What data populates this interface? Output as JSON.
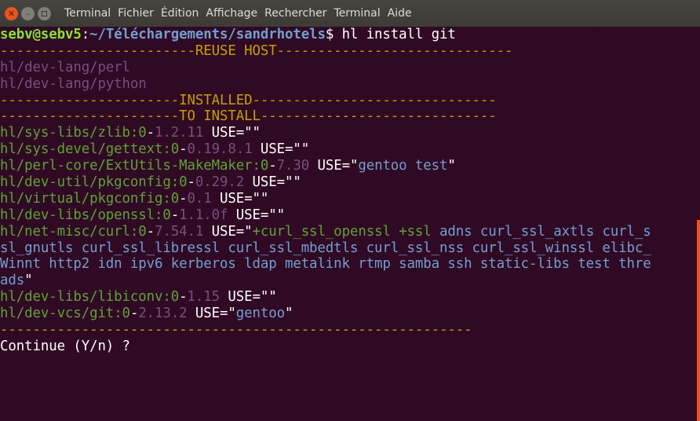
{
  "window": {
    "buttons": {
      "close": "✕",
      "minimize": "–"
    },
    "menu": [
      "Terminal",
      "Fichier",
      "Édition",
      "Affichage",
      "Rechercher",
      "Terminal",
      "Aide"
    ]
  },
  "terminal": {
    "prompt": {
      "user_host": "sebv@sebv5",
      "sep": ":",
      "path": "~/Téléchargements/sandrhotels",
      "symbol": "$ ",
      "command": "hl install git"
    },
    "divider_left": "------------------------",
    "reuse_header": "REUSE HOST",
    "reuse_right": "-----------------------------",
    "reuse_packages": [
      "hl/dev-lang/perl",
      "hl/dev-lang/python"
    ],
    "installed_left": "----------------------",
    "installed_header": "INSTALLED",
    "installed_right": "------------------------------",
    "to_install_header": "TO INSTALL",
    "to_install_right": "-----------------------------",
    "to_install_packages": [
      {
        "name": "hl/sys-libs/zlib",
        "slot": ":0",
        "dash": "-",
        "version": "1.2.11",
        "use_prefix": " USE=\"",
        "use_value": "",
        "use_suffix": "\""
      },
      {
        "name": "hl/sys-devel/gettext",
        "slot": ":0",
        "dash": "-",
        "version": "0.19.8.1",
        "use_prefix": " USE=\"",
        "use_value": "",
        "use_suffix": "\""
      },
      {
        "name": "hl/perl-core/ExtUtils-MakeMaker",
        "slot": ":0",
        "dash": "-",
        "version": "7.30",
        "use_prefix": " USE=\"",
        "use_value": "gentoo test",
        "use_suffix": "\""
      },
      {
        "name": "hl/dev-util/pkgconfig",
        "slot": ":0",
        "dash": "-",
        "version": "0.29.2",
        "use_prefix": " USE=\"",
        "use_value": "",
        "use_suffix": "\""
      },
      {
        "name": "hl/virtual/pkgconfig",
        "slot": ":0",
        "dash": "-",
        "version": "0.1",
        "use_prefix": " USE=\"",
        "use_value": "",
        "use_suffix": "\""
      },
      {
        "name": "hl/dev-libs/openssl",
        "slot": ":0",
        "dash": "-",
        "version": "1.1.0f",
        "use_prefix": " USE=\"",
        "use_value": "",
        "use_suffix": "\""
      }
    ],
    "curl": {
      "name": "hl/net-misc/curl",
      "slot": ":0",
      "dash": "-",
      "version": "7.54.1",
      "use_prefix": " USE=\"",
      "enabled1": "+curl_ssl_openssl",
      "space": " ",
      "enabled2": "+ssl",
      "rest1": " adns curl_ssl_axtls curl_s",
      "line2": "sl_gnutls curl_ssl_libressl curl_ssl_mbedtls curl_ssl_nss curl_ssl_winssl elibc_",
      "line3": "Winnt http2 idn ipv6 kerberos ldap metalink rtmp samba ssh static-libs test thre",
      "line4": "ads",
      "use_suffix": "\""
    },
    "more_packages": [
      {
        "name": "hl/dev-libs/libiconv",
        "slot": ":0",
        "dash": "-",
        "version": "1.15",
        "use_prefix": " USE=\"",
        "use_value": "",
        "use_suffix": "\""
      },
      {
        "name": "hl/dev-vcs/git",
        "slot": ":0",
        "dash": "-",
        "version": "2.13.2",
        "use_prefix": " USE=\"",
        "use_value": "gentoo",
        "use_suffix": "\""
      }
    ],
    "footer_divider": "----------------------------------------------------------",
    "question": "Continue (Y/n) ?"
  }
}
